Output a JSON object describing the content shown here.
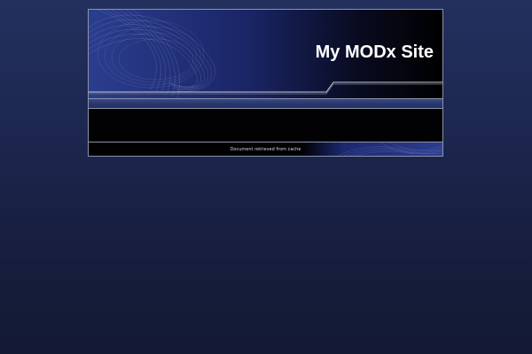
{
  "header": {
    "site_title": "My MODx Site"
  },
  "footer": {
    "cache_status": "Document retrieved from cache"
  },
  "colors": {
    "page_background": "#1d2750",
    "panel_background": "#000000",
    "accent_blue": "#2a3770",
    "border": "#8c93a8"
  }
}
